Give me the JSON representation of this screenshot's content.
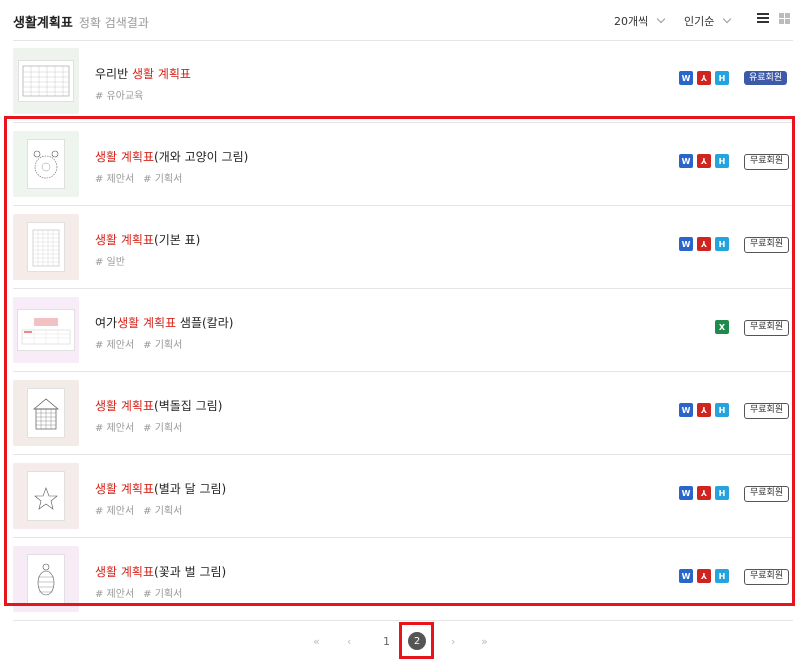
{
  "header": {
    "title": "생활계획표",
    "subtitle": "정확 검색결과",
    "per_page": "20개씩",
    "sort": "인기순"
  },
  "rows": [
    {
      "title_prefix": "우리반 ",
      "title_highlight": "생활 계획표",
      "title_suffix": "",
      "tags": [
        "# 유아교육"
      ],
      "badge": "유료회원",
      "badge_type": "paid",
      "thumb_bg": "#eef3ee"
    },
    {
      "title_prefix": "",
      "title_highlight": "생활 계획표",
      "title_suffix": "(개와 고양이 그림)",
      "tags": [
        "# 제안서",
        "# 기획서"
      ],
      "badge": "무료회원",
      "badge_type": "free",
      "thumb_bg": "#eef4ee"
    },
    {
      "title_prefix": "",
      "title_highlight": "생활 계획표",
      "title_suffix": "(기본 표)",
      "tags": [
        "# 일반"
      ],
      "badge": "무료회원",
      "badge_type": "free",
      "thumb_bg": "#f5ebe9"
    },
    {
      "title_prefix": "여가",
      "title_highlight": "생활 계획표",
      "title_suffix": " 샘플(칼라)",
      "tags": [
        "# 제안서",
        "# 기획서"
      ],
      "badge": "무료회원",
      "badge_type": "free",
      "thumb_bg": "#f7ecf7"
    },
    {
      "title_prefix": "",
      "title_highlight": "생활 계획표",
      "title_suffix": "(벽돌집 그림)",
      "tags": [
        "# 제안서",
        "# 기획서"
      ],
      "badge": "무료회원",
      "badge_type": "free",
      "thumb_bg": "#f3ebe8"
    },
    {
      "title_prefix": "",
      "title_highlight": "생활 계획표",
      "title_suffix": "(별과 달 그림)",
      "tags": [
        "# 제안서",
        "# 기획서"
      ],
      "badge": "무료회원",
      "badge_type": "free",
      "thumb_bg": "#f4ebea"
    },
    {
      "title_prefix": "",
      "title_highlight": "생활 계획표",
      "title_suffix": "(꽃과 벌 그림)",
      "tags": [
        "# 제안서",
        "# 기획서"
      ],
      "badge": "무료회원",
      "badge_type": "free",
      "thumb_bg": "#f7ecf5"
    }
  ],
  "file_icons": {
    "word": "W",
    "pdf": "PDF",
    "hwp": "H",
    "excel": "X"
  },
  "pagination": {
    "first": "«",
    "prev": "‹",
    "page1": "1",
    "current": "2",
    "next": "›",
    "last": "»"
  }
}
